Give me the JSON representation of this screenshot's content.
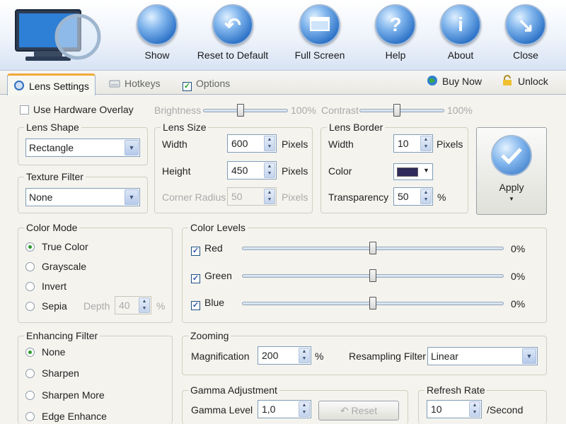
{
  "toolbar": {
    "buttons": [
      {
        "label": "Show",
        "icon": "show-icon"
      },
      {
        "label": "Reset to Default",
        "icon": "reset-arrow-icon"
      },
      {
        "label": "Full Screen",
        "icon": "fullscreen-icon"
      },
      {
        "label": "Help",
        "icon": "help-icon"
      },
      {
        "label": "About",
        "icon": "info-icon"
      },
      {
        "label": "Close",
        "icon": "close-arrow-icon"
      }
    ]
  },
  "tabs": {
    "items": [
      {
        "label": "Lens Settings",
        "active": true
      },
      {
        "label": "Hotkeys",
        "active": false
      },
      {
        "label": "Options",
        "active": false
      }
    ],
    "buy_now": "Buy Now",
    "unlock": "Unlock"
  },
  "top_row": {
    "hw_overlay": "Use Hardware Overlay",
    "brightness_label": "Brightness",
    "brightness_value": "100%",
    "brightness_fraction": 0.44,
    "contrast_label": "Contrast",
    "contrast_value": "100%",
    "contrast_fraction": 0.44
  },
  "lens_shape": {
    "title": "Lens Shape",
    "value": "Rectangle"
  },
  "texture_filter": {
    "title": "Texture Filter",
    "value": "None"
  },
  "lens_size": {
    "title": "Lens Size",
    "width_label": "Width",
    "width_value": "600",
    "width_unit": "Pixels",
    "height_label": "Height",
    "height_value": "450",
    "height_unit": "Pixels",
    "corner_label": "Corner Radius",
    "corner_value": "50",
    "corner_unit": "Pixels"
  },
  "lens_border": {
    "title": "Lens Border",
    "width_label": "Width",
    "width_value": "10",
    "width_unit": "Pixels",
    "color_label": "Color",
    "color_hex": "#2e2a5a",
    "transparency_label": "Transparency",
    "transparency_value": "50",
    "transparency_unit": "%"
  },
  "apply": {
    "label": "Apply"
  },
  "color_mode": {
    "title": "Color Mode",
    "options": [
      "True Color",
      "Grayscale",
      "Invert",
      "Sepia"
    ],
    "selected": 0,
    "depth_label": "Depth",
    "depth_value": "40",
    "depth_unit": "%"
  },
  "color_levels": {
    "title": "Color Levels",
    "channels": [
      {
        "label": "Red",
        "value": "0%",
        "fraction": 0.5
      },
      {
        "label": "Green",
        "value": "0%",
        "fraction": 0.5
      },
      {
        "label": "Blue",
        "value": "0%",
        "fraction": 0.5
      }
    ]
  },
  "enhancing_filter": {
    "title": "Enhancing Filter",
    "options": [
      "None",
      "Sharpen",
      "Sharpen More",
      "Edge Enhance"
    ],
    "selected": 0
  },
  "zooming": {
    "title": "Zooming",
    "magnification_label": "Magnification",
    "magnification_value": "200",
    "magnification_unit": "%",
    "resampling_label": "Resampling Filter",
    "resampling_value": "Linear"
  },
  "gamma": {
    "title": "Gamma Adjustment",
    "level_label": "Gamma Level",
    "level_value": "1,0",
    "reset_label": "Reset"
  },
  "refresh": {
    "title": "Refresh Rate",
    "value": "10",
    "unit": "/Second"
  },
  "colors": {
    "accent_orange": "#f0a93a",
    "check_green": "#21a121",
    "lens_border_color": "#2e2a5a"
  }
}
